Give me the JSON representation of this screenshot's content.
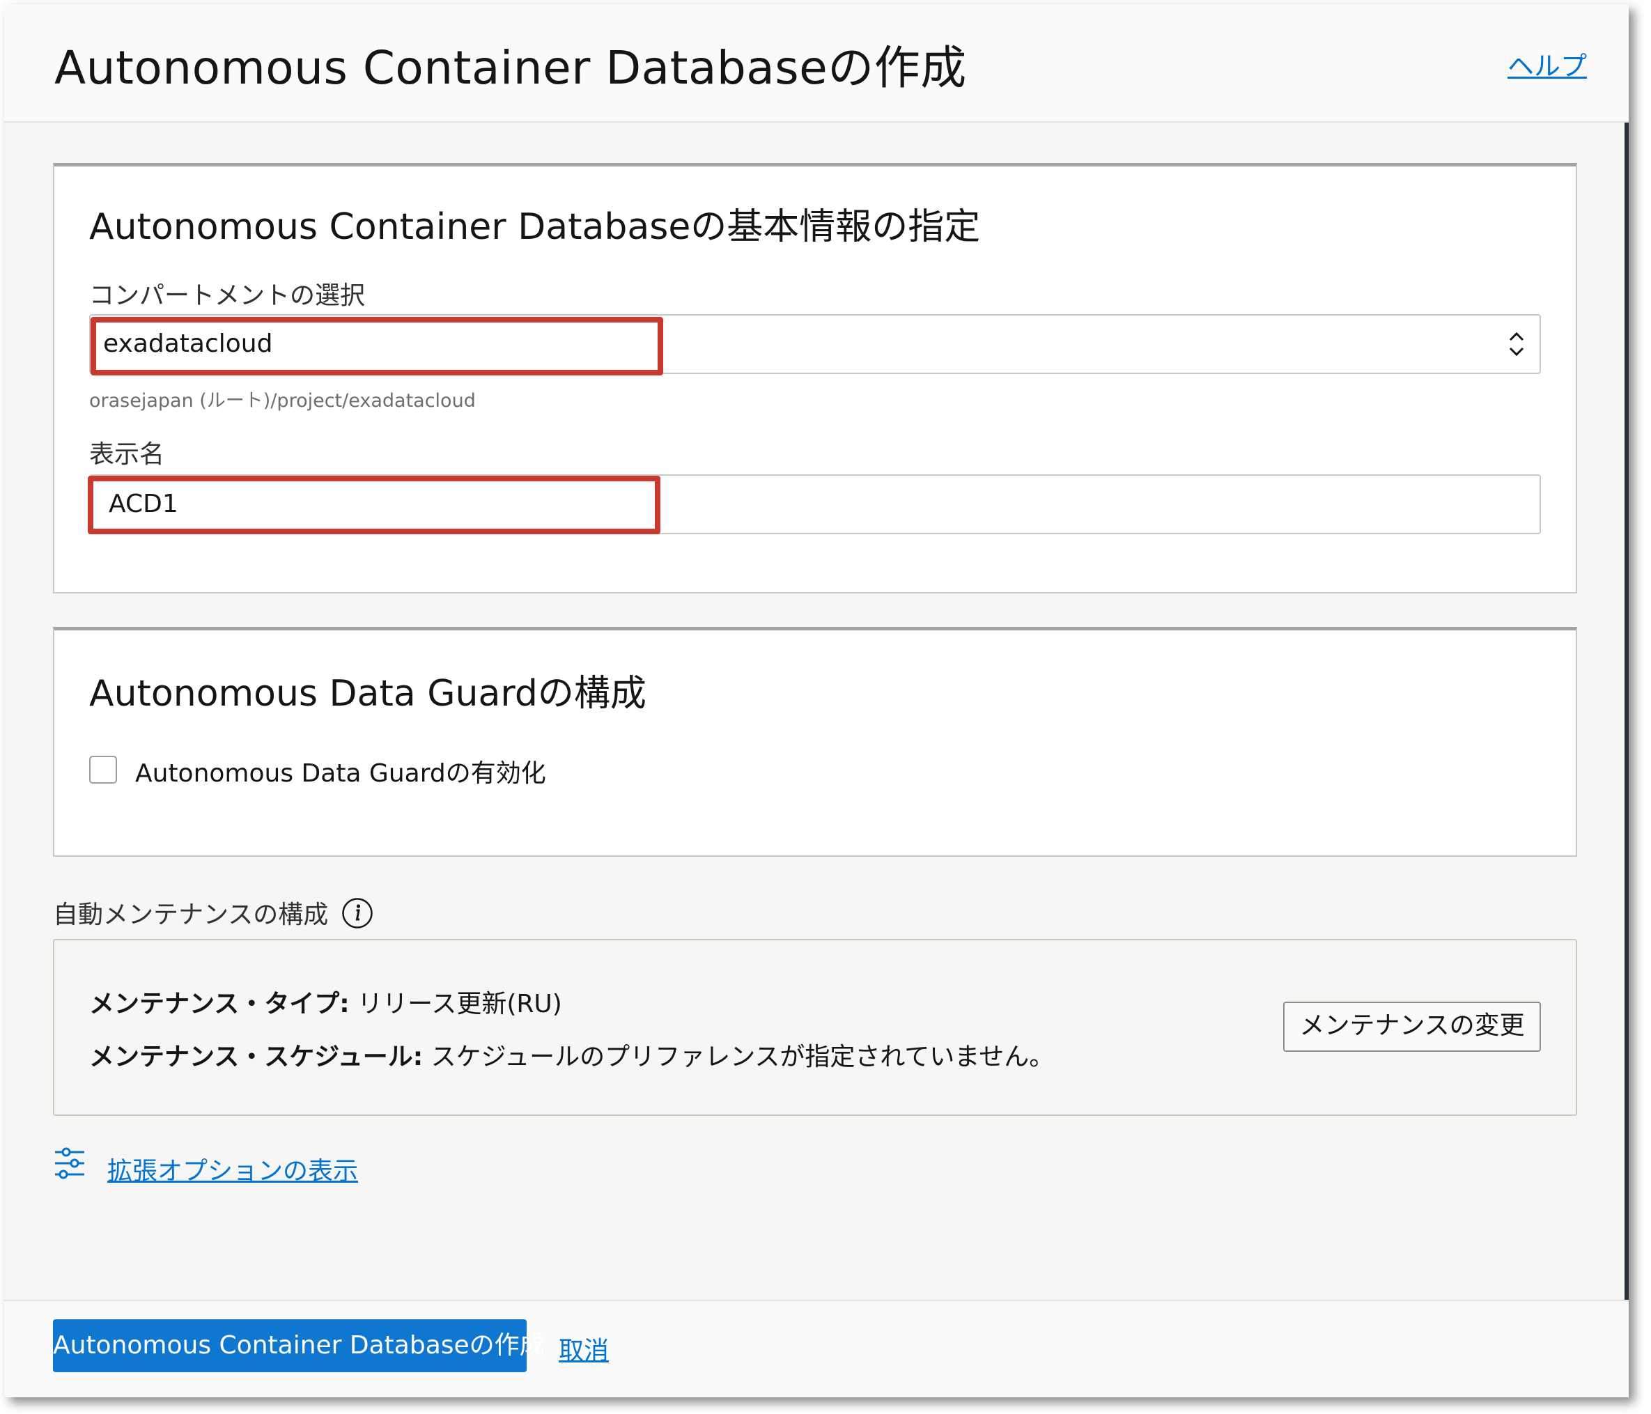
{
  "header": {
    "title": "Autonomous Container Databaseの作成",
    "help_link": "ヘルプ"
  },
  "basic_info": {
    "title": "Autonomous Container Databaseの基本情報の指定",
    "compartment_label": "コンパートメントの選択",
    "compartment_value": "exadatacloud",
    "compartment_path": "orasejapan (ルート)/project/exadatacloud",
    "display_name_label": "表示名",
    "display_name_value": "ACD1"
  },
  "data_guard": {
    "title": "Autonomous Data Guardの構成",
    "checkbox_label": "Autonomous Data Guardの有効化",
    "checked": false
  },
  "maintenance": {
    "section_label": "自動メンテナンスの構成",
    "type_label": "メンテナンス・タイプ:",
    "type_value": "リリース更新(RU)",
    "schedule_label": "メンテナンス・スケジュール:",
    "schedule_value": "スケジュールのプリファレンスが指定されていません。",
    "change_button": "メンテナンスの変更"
  },
  "advanced": {
    "link": "拡張オプションの表示"
  },
  "footer": {
    "create_button": "Autonomous Container Databaseの作成",
    "cancel_link": "取消"
  },
  "colors": {
    "primary": "#0f77cf",
    "link": "#0572ce",
    "highlight": "#c8392f"
  }
}
